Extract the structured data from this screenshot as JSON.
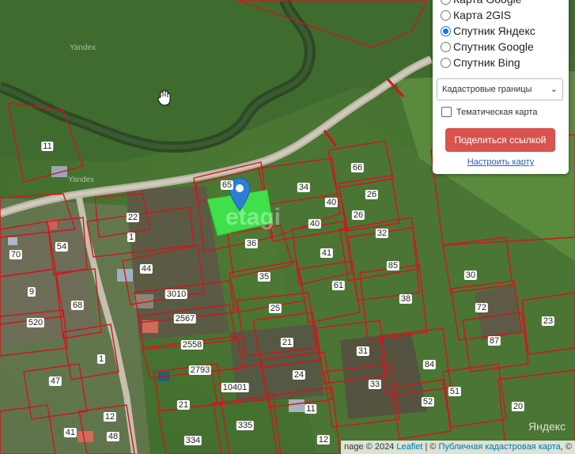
{
  "panel": {
    "layers": [
      {
        "label": "Карта Google",
        "selected": false
      },
      {
        "label": "Карта 2GIS",
        "selected": false
      },
      {
        "label": "Спутник Яндекс",
        "selected": true
      },
      {
        "label": "Спутник Google",
        "selected": false
      },
      {
        "label": "Спутник Bing",
        "selected": false
      }
    ],
    "overlay_select": "Кадастровые границы",
    "thematic_label": "Тематическая карта",
    "thematic_checked": false,
    "share_label": "Поделиться ссылкой",
    "settings_link": "Настроить карту"
  },
  "map": {
    "parcel_labels": [
      "65",
      "34",
      "66",
      "40",
      "26",
      "26",
      "40",
      "32",
      "36",
      "41",
      "85",
      "35",
      "61",
      "30",
      "38",
      "72",
      "25",
      "23",
      "87",
      "21",
      "31",
      "84",
      "24",
      "33",
      "51",
      "52",
      "20",
      "11",
      "12",
      "335",
      "334",
      "21",
      "10401",
      "2793",
      "2558",
      "2567",
      "3010",
      "44",
      "22",
      "1",
      "11",
      "70",
      "54",
      "9",
      "68",
      "520",
      "1",
      "47",
      "41",
      "12",
      "48"
    ],
    "watermarks": [
      "Yandex",
      "Yandex",
      "etagi",
      "Яндекс"
    ],
    "highlight_color": "#3fe04a",
    "marker_color": "#2b7fd4",
    "parcel_color": "#d0161d"
  },
  "attribution": {
    "prefix": "nage © 2024 ",
    "leaflet": "Leaflet",
    "separator": " | © ",
    "registry": "Публичная кадастровая карта",
    "suffix": ", ©"
  }
}
